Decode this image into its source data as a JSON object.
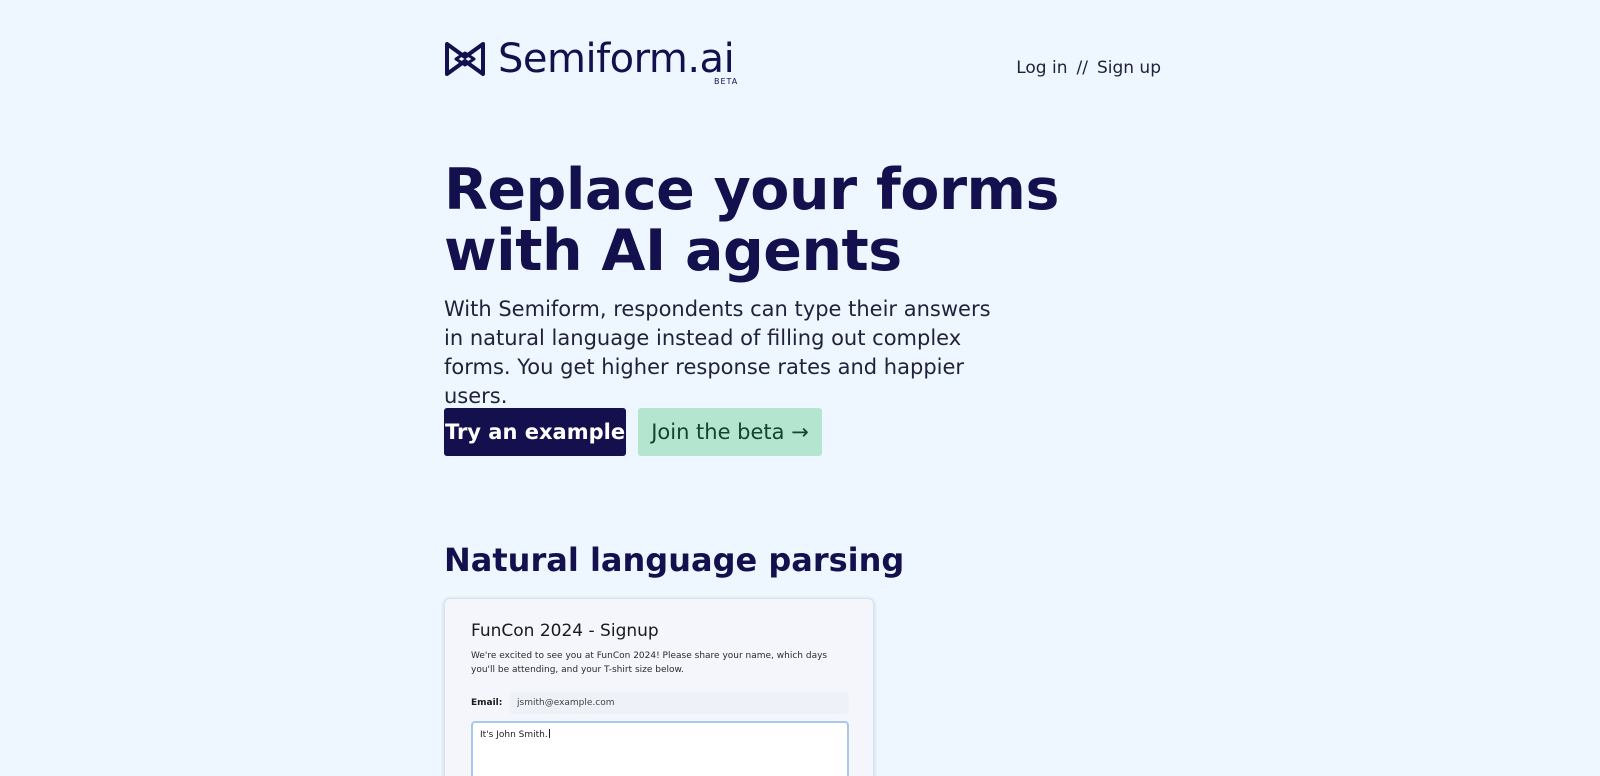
{
  "header": {
    "brand": "Semiform.ai",
    "badge": "BETA",
    "nav": {
      "login": "Log in",
      "separator": "//",
      "signup": "Sign up"
    }
  },
  "hero": {
    "title": "Replace your forms with AI agents",
    "subtitle": "With Semiform, respondents can type their answers in natural language instead of filling out complex forms. You get higher response rates and happier users.",
    "primary_button": "Try an example",
    "secondary_button": "Join the beta →"
  },
  "section": {
    "title": "Natural language parsing"
  },
  "demo_form": {
    "title": "FunCon 2024 - Signup",
    "description": "We're excited to see you at FunCon 2024! Please share your name, which days you'll be attending, and your T-shirt size below.",
    "email_label": "Email:",
    "email_value": "jsmith@example.com",
    "message_text": "It's John Smith."
  },
  "colors": {
    "background": "#eef7ff",
    "brand": "#13104d",
    "accent_green": "#b4e5cf"
  },
  "icons": {
    "logo": "bowtie-logo-icon"
  }
}
